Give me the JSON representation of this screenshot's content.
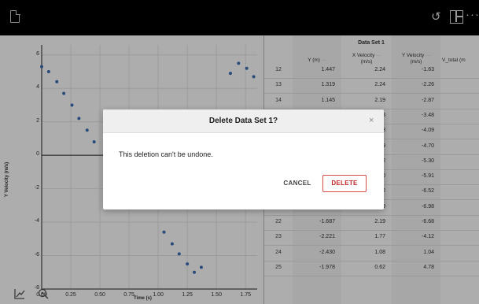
{
  "colors": {
    "accent_red": "#c62828",
    "point_blue": "#3b6fb6",
    "overlay": "rgba(0,0,0,0.32)"
  },
  "toolbar": {
    "document_icon": "document-icon",
    "undo_icon": "undo-icon",
    "undo_glyph": "↺",
    "layout_icon": "layout-icon",
    "more_icon": "more-icon",
    "more_glyph": "···"
  },
  "graph": {
    "y_axis_label": "Y Velocity (m/s)",
    "x_axis_label": "Time (s)",
    "y_ticks": [
      "6",
      "4",
      "2",
      "0",
      "-2",
      "-4",
      "-6",
      "-8"
    ],
    "x_ticks": [
      "0.00",
      "0.25",
      "0.50",
      "0.75",
      "1.00",
      "1.25",
      "1.50",
      "1.75"
    ],
    "tool_icons": [
      "graph-tool-icon",
      "zoom-icon"
    ]
  },
  "chart_data": {
    "type": "scatter",
    "xlabel": "Time (s)",
    "ylabel": "Y Velocity (m/s)",
    "xlim": [
      0,
      1.85
    ],
    "ylim": [
      -8,
      6.6
    ],
    "x_ticks": [
      0,
      0.25,
      0.5,
      0.75,
      1.0,
      1.25,
      1.5,
      1.75
    ],
    "y_ticks": [
      6,
      4,
      2,
      0,
      -2,
      -4,
      -6,
      -8
    ],
    "points": [
      {
        "x": 0.0,
        "y": 5.3
      },
      {
        "x": 0.06,
        "y": 5.0
      },
      {
        "x": 0.13,
        "y": 4.4
      },
      {
        "x": 0.19,
        "y": 3.7
      },
      {
        "x": 0.26,
        "y": 3.0
      },
      {
        "x": 0.32,
        "y": 2.2
      },
      {
        "x": 0.39,
        "y": 1.5
      },
      {
        "x": 0.45,
        "y": 0.8
      },
      {
        "x": 1.05,
        "y": -4.6
      },
      {
        "x": 1.12,
        "y": -5.3
      },
      {
        "x": 1.18,
        "y": -5.9
      },
      {
        "x": 1.25,
        "y": -6.5
      },
      {
        "x": 1.31,
        "y": -7.0
      },
      {
        "x": 1.37,
        "y": -6.7
      },
      {
        "x": 1.62,
        "y": 4.9
      },
      {
        "x": 1.69,
        "y": 5.5
      },
      {
        "x": 1.76,
        "y": 5.2
      },
      {
        "x": 1.82,
        "y": 4.7
      }
    ]
  },
  "table": {
    "dataset_title": "Data Set 1",
    "columns": [
      {
        "label_line1": "Y (m)",
        "label_line2": "",
        "menu": "···"
      },
      {
        "label_line1": "X Velocity",
        "label_line2": "(m/s)",
        "menu": "···"
      },
      {
        "label_line1": "Y Velocity",
        "label_line2": "(m/s)",
        "menu": "···"
      },
      {
        "label_line1": "V_total (m",
        "label_line2": "",
        "menu": ""
      }
    ],
    "rows": [
      {
        "idx": "12",
        "y": "1.447",
        "xv": "2.24",
        "yv": "-1.63"
      },
      {
        "idx": "13",
        "y": "1.319",
        "xv": "2.24",
        "yv": "-2.26"
      },
      {
        "idx": "14",
        "y": "1.145",
        "xv": "2.19",
        "yv": "-2.87"
      },
      {
        "idx": "15",
        "y": "",
        "xv": "18",
        "yv": "-3.48"
      },
      {
        "idx": "16",
        "y": "",
        "xv": "18",
        "yv": "-4.09"
      },
      {
        "idx": "17",
        "y": "",
        "xv": "19",
        "yv": "-4.70"
      },
      {
        "idx": "18",
        "y": "",
        "xv": "22",
        "yv": "-5.30"
      },
      {
        "idx": "19",
        "y": "",
        "xv": "20",
        "yv": "-5.91"
      },
      {
        "idx": "20",
        "y": "",
        "xv": "22",
        "yv": "-6.52"
      },
      {
        "idx": "21",
        "y": "-1.188",
        "xv": "2.29",
        "yv": "-6.98"
      },
      {
        "idx": "22",
        "y": "-1.687",
        "xv": "2.19",
        "yv": "-6.68"
      },
      {
        "idx": "23",
        "y": "-2.221",
        "xv": "1.77",
        "yv": "-4.12"
      },
      {
        "idx": "24",
        "y": "-2.430",
        "xv": "1.08",
        "yv": "1.04"
      },
      {
        "idx": "25",
        "y": "-1.978",
        "xv": "0.62",
        "yv": "4.78"
      }
    ]
  },
  "dialog": {
    "title": "Delete Data Set 1?",
    "close_glyph": "×",
    "message": "This deletion can't be undone.",
    "cancel_label": "CANCEL",
    "delete_label": "DELETE"
  }
}
